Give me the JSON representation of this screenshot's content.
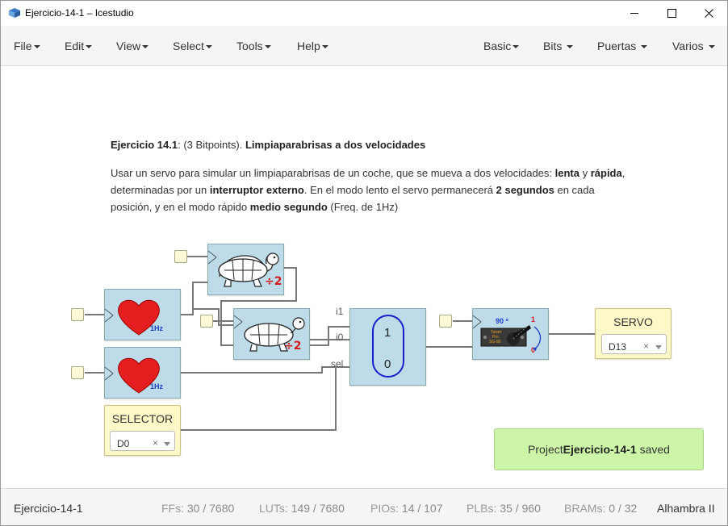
{
  "window": {
    "title": "Ejercicio-14-1 – Icestudio",
    "min_glyph": "—",
    "close_glyph": "✕"
  },
  "menubar": {
    "left": [
      "File",
      "Edit",
      "View",
      "Select",
      "Tools",
      "Help"
    ],
    "right": [
      "Basic",
      "Bits",
      "Puertas",
      "Varios"
    ]
  },
  "description": {
    "title_bold": "Ejercicio 14.1",
    "title_rest1": ": (3 Bitpoints). ",
    "title_bold2": "Limpiaparabrisas a dos velocidades",
    "p1": "Usar un servo para simular un limpiaparabrisas de un coche, que se mueva a dos velocidades: ",
    "p1_b1": "lenta",
    "p1_t2": " y ",
    "p1_b2": "rápida",
    "p1_t3": ",",
    "p2": "determinadas por un ",
    "p2_b1": "interruptor externo",
    "p2_t2": ". En el modo lento el servo permanecerá ",
    "p2_b2": "2 segundos",
    "p2_t3": " en cada",
    "p3": "posición, y en el modo rápido ",
    "p3_b1": "medio segundo",
    "p3_t2": " (Freq. de 1Hz)"
  },
  "schematic": {
    "heart_label": "1Hz",
    "divider_label": "÷2",
    "mux": {
      "in1": "i1",
      "in0": "i0",
      "sel": "sel",
      "top": "1",
      "bottom": "0"
    },
    "servo_block": {
      "angle": "90 º",
      "one": "1",
      "zero": "0",
      "chip": [
        "Tower",
        "Pro",
        "SG-90"
      ]
    },
    "selector": {
      "label": "SELECTOR",
      "value": "D0",
      "clear": "×"
    },
    "servo": {
      "label": "SERVO",
      "value": "D13",
      "clear": "×"
    }
  },
  "toast": {
    "prefix": "Project ",
    "name": "Ejercicio-14-1",
    "suffix": " saved"
  },
  "statusbar": {
    "project": "Ejercicio-14-1",
    "ffs_label": "FFs:",
    "ffs": "30 / 7680",
    "luts_label": "LUTs:",
    "luts": "149 / 7680",
    "pios_label": "PIOs:",
    "pios": "14 / 107",
    "plbs_label": "PLBs:",
    "plbs": "35 / 960",
    "brams_label": "BRAMs:",
    "brams": "0 / 32",
    "board": "Alhambra II"
  }
}
